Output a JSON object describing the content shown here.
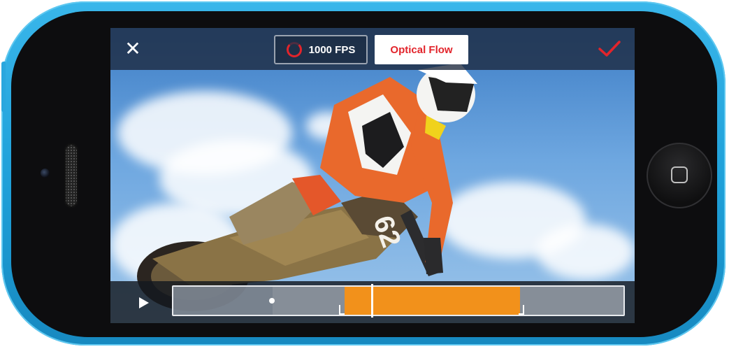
{
  "toolbar": {
    "close_icon": "close-icon",
    "fps_label": "1000 FPS",
    "fps_icon": "record-ring-icon",
    "mode_label": "Optical Flow",
    "confirm_icon": "checkmark-icon",
    "accent_color": "#e2242b"
  },
  "timeline": {
    "play_icon": "play-icon",
    "slow_motion_color": "#f2911b",
    "slow_motion_start": 0.38,
    "slow_motion_end": 0.77,
    "playhead_position": 0.44
  },
  "device": {
    "home_button_icon": "home-square-icon",
    "shell_color": "#1e9fd8"
  }
}
